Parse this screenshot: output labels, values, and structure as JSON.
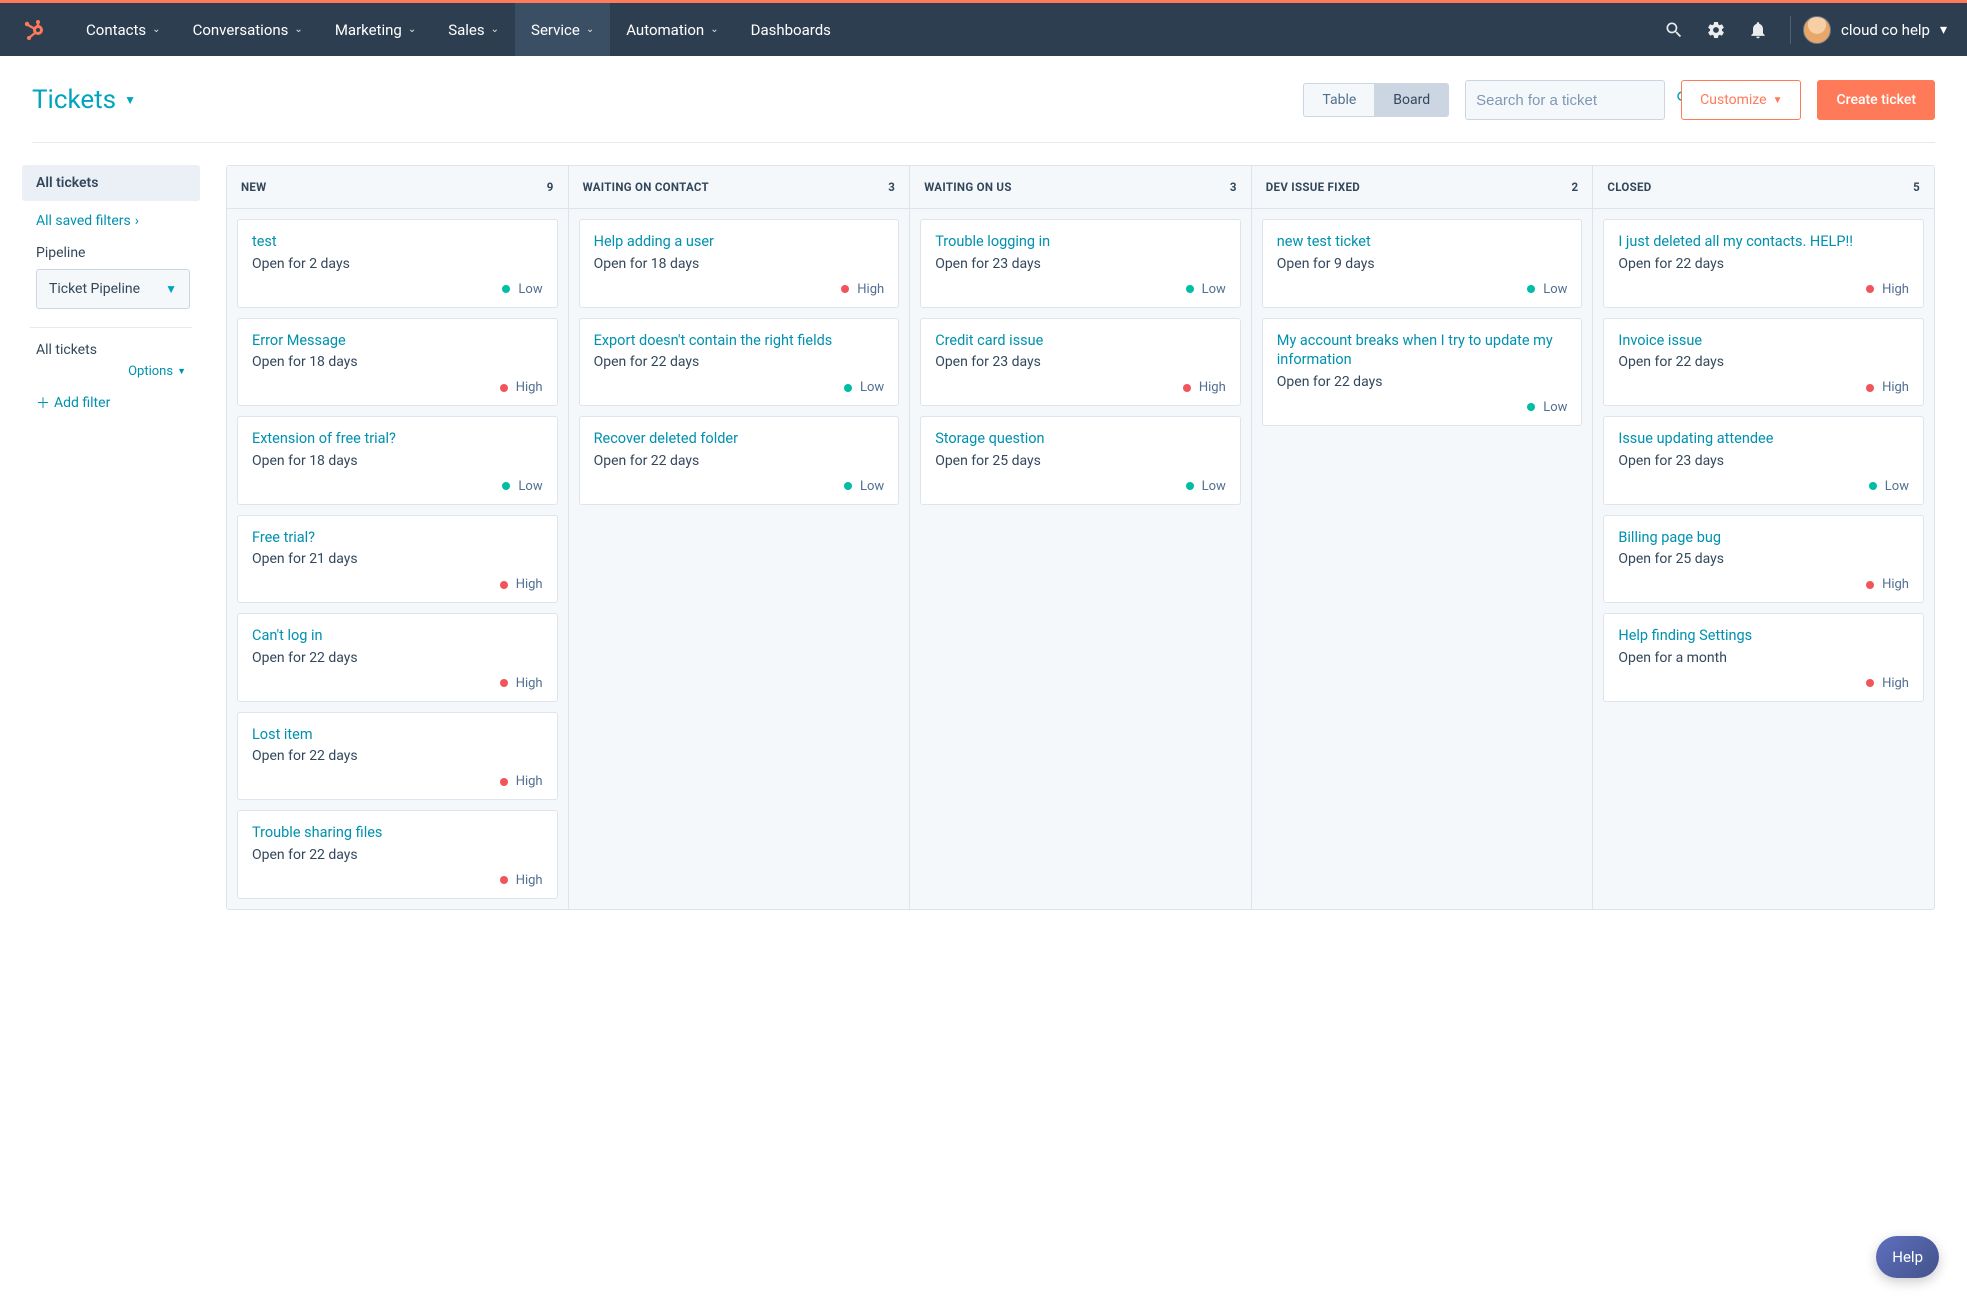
{
  "nav": {
    "items": [
      {
        "label": "Contacts",
        "caret": true
      },
      {
        "label": "Conversations",
        "caret": true
      },
      {
        "label": "Marketing",
        "caret": true
      },
      {
        "label": "Sales",
        "caret": true
      },
      {
        "label": "Service",
        "caret": true,
        "active": true
      },
      {
        "label": "Automation",
        "caret": true
      },
      {
        "label": "Dashboards",
        "caret": false
      }
    ],
    "account_name": "cloud co help"
  },
  "header": {
    "title": "Tickets",
    "view_table_label": "Table",
    "view_board_label": "Board",
    "search_placeholder": "Search for a ticket",
    "customize_label": "Customize",
    "create_label": "Create ticket"
  },
  "sidebar": {
    "all_tickets": "All tickets",
    "all_saved_filters": "All saved filters",
    "pipeline_label": "Pipeline",
    "pipeline_value": "Ticket Pipeline",
    "all_tickets2": "All tickets",
    "options": "Options",
    "add_filter": "Add filter"
  },
  "board": {
    "columns": [
      {
        "name": "NEW",
        "count": "9",
        "cards": [
          {
            "title": "test",
            "sub": "Open for 2 days",
            "priority": "Low"
          },
          {
            "title": "Error Message",
            "sub": "Open for 18 days",
            "priority": "High"
          },
          {
            "title": "Extension of free trial?",
            "sub": "Open for 18 days",
            "priority": "Low"
          },
          {
            "title": "Free trial?",
            "sub": "Open for 21 days",
            "priority": "High"
          },
          {
            "title": "Can't log in",
            "sub": "Open for 22 days",
            "priority": "High"
          },
          {
            "title": "Lost item",
            "sub": "Open for 22 days",
            "priority": "High"
          },
          {
            "title": "Trouble sharing files",
            "sub": "Open for 22 days",
            "priority": "High"
          }
        ]
      },
      {
        "name": "WAITING ON CONTACT",
        "count": "3",
        "cards": [
          {
            "title": "Help adding a user",
            "sub": "Open for 18 days",
            "priority": "High"
          },
          {
            "title": "Export doesn't contain the right fields",
            "sub": "Open for 22 days",
            "priority": "Low"
          },
          {
            "title": "Recover deleted folder",
            "sub": "Open for 22 days",
            "priority": "Low"
          }
        ]
      },
      {
        "name": "WAITING ON US",
        "count": "3",
        "cards": [
          {
            "title": "Trouble logging in",
            "sub": "Open for 23 days",
            "priority": "Low"
          },
          {
            "title": "Credit card issue",
            "sub": "Open for 23 days",
            "priority": "High"
          },
          {
            "title": "Storage question",
            "sub": "Open for 25 days",
            "priority": "Low"
          }
        ]
      },
      {
        "name": "DEV ISSUE FIXED",
        "count": "2",
        "cards": [
          {
            "title": "new test ticket",
            "sub": "Open for 9 days",
            "priority": "Low"
          },
          {
            "title": "My account breaks when I try to update my information",
            "sub": "Open for 22 days",
            "priority": "Low"
          }
        ]
      },
      {
        "name": "CLOSED",
        "count": "5",
        "cards": [
          {
            "title": "I just deleted all my contacts. HELP!!",
            "sub": "Open for 22 days",
            "priority": "High"
          },
          {
            "title": "Invoice issue",
            "sub": "Open for 22 days",
            "priority": "High"
          },
          {
            "title": "Issue updating attendee",
            "sub": "Open for 23 days",
            "priority": "Low"
          },
          {
            "title": "Billing page bug",
            "sub": "Open for 25 days",
            "priority": "High"
          },
          {
            "title": "Help finding Settings",
            "sub": "Open for a month",
            "priority": "High"
          }
        ]
      }
    ]
  },
  "help_fab": "Help"
}
